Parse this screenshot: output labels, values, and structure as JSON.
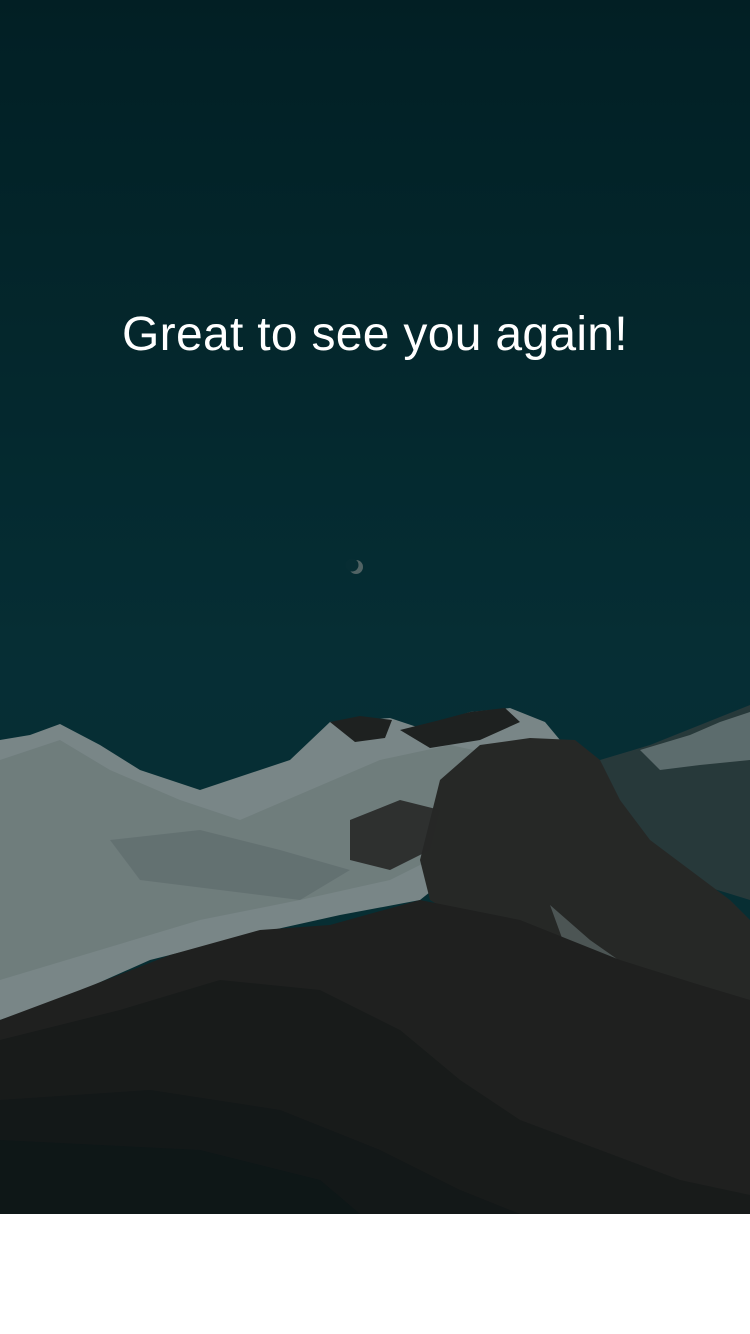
{
  "welcome": {
    "greeting": "Great to see you again!"
  },
  "background": {
    "scene": "mountain-night-landscape",
    "sky_color_top": "#022329",
    "sky_color_mid": "#083a42",
    "snow_color": "#c9cfcf",
    "rock_color": "#2a2220",
    "overlay_opacity": 0.55
  },
  "footer": {
    "background_color": "#ffffff"
  }
}
